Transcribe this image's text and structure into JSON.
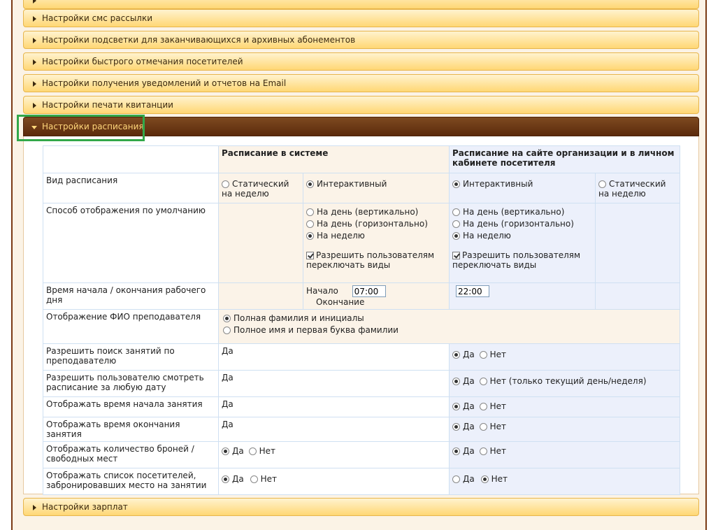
{
  "accordion": {
    "sections": [
      {
        "label": "Настройки смс рассылки"
      },
      {
        "label": "Настройки подсветки для заканчивающихся и архивных абонементов"
      },
      {
        "label": "Настройки быстрого отмечания посетителей"
      },
      {
        "label": "Настройки получения уведомлений и отчетов на Email"
      },
      {
        "label": "Настройки печати квитанции"
      }
    ],
    "open_section": {
      "label": "Настройки расписания"
    },
    "bottom_section": {
      "label": "Настройки зарплат"
    }
  },
  "schedule": {
    "headers": {
      "system": "Расписание в системе",
      "site": "Расписание на сайте организации и в личном кабинете посетителя"
    },
    "rows": {
      "type": {
        "label": "Вид расписания",
        "sys_static": "Статический на неделю",
        "sys_interactive": "Интерактивный",
        "site_interactive": "Интерактивный",
        "site_static": "Статический на неделю"
      },
      "display": {
        "label": "Способ отображения по умолчанию",
        "opt_day_v": "На день (вертикально)",
        "opt_day_h": "На день (горизонтально)",
        "opt_week": "На неделю",
        "allow_switch": "Разрешить пользователям переключать виды"
      },
      "worktime": {
        "label": "Время начала / окончания рабочего дня",
        "start_label": "Начало",
        "start_value": "07:00",
        "end_label": "Окончание",
        "end_value": "22:00"
      },
      "teacher_name": {
        "label": "Отображение ФИО преподавателя",
        "opt_full": "Полная фамилия и инициалы",
        "opt_first": "Полное имя и первая буква фамилии"
      },
      "search_teacher": {
        "label": "Разрешить поиск занятий по преподавателю",
        "sys_value": "Да",
        "yes": "Да",
        "no": "Нет"
      },
      "any_date": {
        "label": "Разрешить пользователю смотреть расписание за любую дату",
        "sys_value": "Да",
        "yes": "Да",
        "no": "Нет (только текущий день/неделя)"
      },
      "show_start": {
        "label": "Отображать время начала занятия",
        "sys_value": "Да",
        "yes": "Да",
        "no": "Нет"
      },
      "show_end": {
        "label": "Отображать время окончания занятия",
        "sys_value": "Да",
        "yes": "Да",
        "no": "Нет"
      },
      "bookings": {
        "label": "Отображать количество броней / свободных мест",
        "yes": "Да",
        "no": "Нет"
      },
      "visitors": {
        "label": "Отображать список посетителей, забронировавших место на занятии",
        "yes": "Да",
        "no": "Нет"
      }
    }
  },
  "colors": {
    "accordion_gradient_top": "#fff3cf",
    "accordion_gradient_bottom": "#ffd774",
    "open_header": "#6b3614",
    "open_header_text": "#ffd67a",
    "highlight_box": "#32a84a"
  }
}
